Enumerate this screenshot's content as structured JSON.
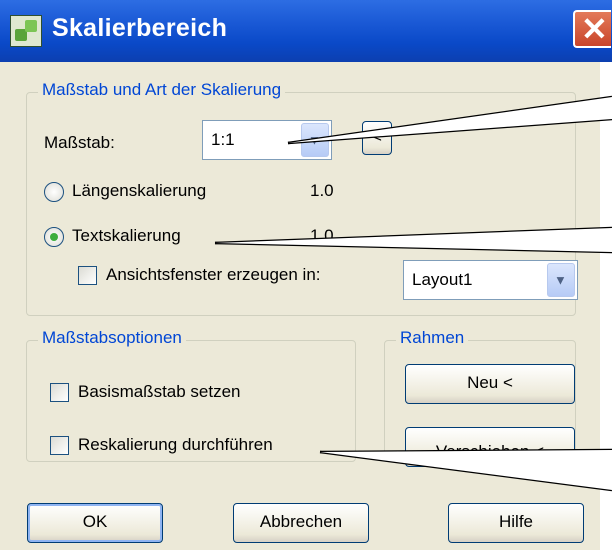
{
  "window": {
    "title": "Skalierbereich"
  },
  "group_scale": {
    "legend": "Maßstab und Art der Skalierung",
    "scale_label": "Maßstab:",
    "scale_value": "1:1",
    "pick_button": "<",
    "radio_length": {
      "label": "Längenskalierung",
      "value": "1.0",
      "selected": false
    },
    "radio_text": {
      "label": "Textskalierung",
      "value": "1.0",
      "selected": true
    },
    "viewport_check": {
      "label": "Ansichtsfenster erzeugen in:",
      "checked": false
    },
    "layout_value": "Layout1"
  },
  "group_options": {
    "legend": "Maßstabsoptionen",
    "base_scale": {
      "label": "Basismaßstab setzen",
      "checked": false
    },
    "rescale": {
      "label": "Reskalierung durchführen",
      "checked": false
    }
  },
  "group_frame": {
    "legend": "Rahmen",
    "new_button": "Neu <",
    "move_button": "Verschieben <"
  },
  "buttons": {
    "ok": "OK",
    "cancel": "Abbrechen",
    "help": "Hilfe"
  }
}
